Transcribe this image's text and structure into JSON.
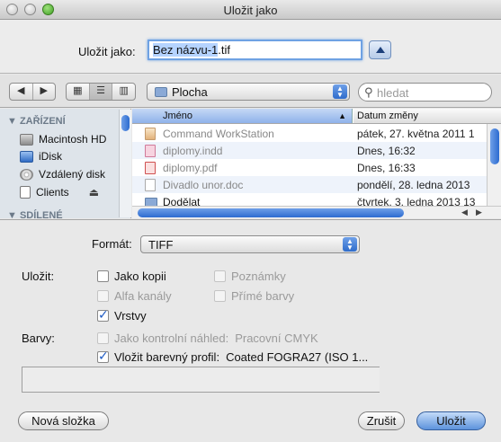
{
  "window": {
    "title": "Uložit jako"
  },
  "save": {
    "label": "Uložit jako:",
    "filename_selected": "Bez názvu-1",
    "filename_ext": ".tif"
  },
  "toolbar": {
    "nav_back": "◀",
    "nav_forward": "▶",
    "view_icon": "▦",
    "view_list": "☰",
    "view_columns": "▥",
    "location": "Plocha",
    "search_placeholder": "hledat"
  },
  "sidebar": {
    "section_devices": "▼ ZAŘÍZENÍ",
    "items": [
      {
        "label": "Macintosh HD",
        "icon": "hard-disk-icon"
      },
      {
        "label": "iDisk",
        "icon": "idisk-icon"
      },
      {
        "label": "Vzdálený disk",
        "icon": "remote-disc-icon"
      },
      {
        "label": "Clients",
        "icon": "drive-icon",
        "eject": "⏏"
      }
    ],
    "section_shared": "▼ SDÍLENÉ"
  },
  "file_list": {
    "col_name": "Jméno",
    "col_date": "Datum změny",
    "sort_indicator": "▲",
    "rows": [
      {
        "name": "Command WorkStation",
        "date": "pátek, 27. května 2011 1",
        "icon": "app-icon",
        "enabled": false
      },
      {
        "name": "diplomy.indd",
        "date": "Dnes, 16:32",
        "icon": "indd-file-icon",
        "enabled": false
      },
      {
        "name": "diplomy.pdf",
        "date": "Dnes, 16:33",
        "icon": "pdf-file-icon",
        "enabled": false
      },
      {
        "name": "Divadlo unor.doc",
        "date": "pondělí, 28. ledna 2013",
        "icon": "doc-file-icon",
        "enabled": false
      },
      {
        "name": "Dodělat",
        "date": "čtvrtek, 3. ledna 2013 13",
        "icon": "folder-icon",
        "enabled": true
      }
    ],
    "h_scroll_left": "◀",
    "h_scroll_right": "▶"
  },
  "options": {
    "format_label": "Formát:",
    "format_value": "TIFF",
    "save_label": "Uložit:",
    "colors_label": "Barvy:",
    "as_copy": "Jako kopii",
    "notes": "Poznámky",
    "alpha": "Alfa kanály",
    "spot": "Přímé barvy",
    "layers": "Vrstvy",
    "proof": "Jako kontrolní náhled:",
    "proof_value": "Pracovní CMYK",
    "embed_profile": "Vložit barevný profil:",
    "profile_value": "Coated FOGRA27 (ISO 1..."
  },
  "buttons": {
    "new_folder": "Nová složka",
    "cancel": "Zrušit",
    "save": "Uložit"
  }
}
